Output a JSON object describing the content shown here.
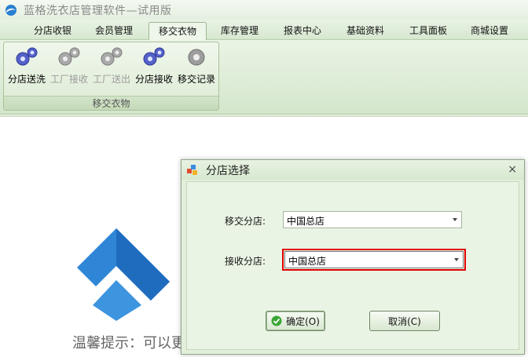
{
  "app": {
    "title": "蓝格洗衣店管理软件—试用版"
  },
  "menu": {
    "tabs": [
      "分店收银",
      "会员管理",
      "移交衣物",
      "库存管理",
      "报表中心",
      "基础资料",
      "工具面板",
      "商城设置"
    ],
    "active_index": 2
  },
  "ribbon": {
    "group_caption": "移交衣物",
    "buttons": [
      {
        "label": "分店送洗",
        "enabled": true
      },
      {
        "label": "工厂接收",
        "enabled": false
      },
      {
        "label": "工厂送出",
        "enabled": false
      },
      {
        "label": "分店接收",
        "enabled": true
      },
      {
        "label": "移交记录",
        "enabled": true
      }
    ]
  },
  "workspace": {
    "tip": "温馨提示：可以更"
  },
  "dialog": {
    "title": "分店选择",
    "close_glyph": "×",
    "transfer_label": "移交分店:",
    "transfer_value": "中国总店",
    "receive_label": "接收分店:",
    "receive_value": "中国总店",
    "ok_label": "确定(O)",
    "cancel_label": "取消(C)"
  },
  "colors": {
    "accent_green": "#d6e7cf",
    "highlight_red": "#e00000",
    "logo_blue": "#2f86d6"
  }
}
